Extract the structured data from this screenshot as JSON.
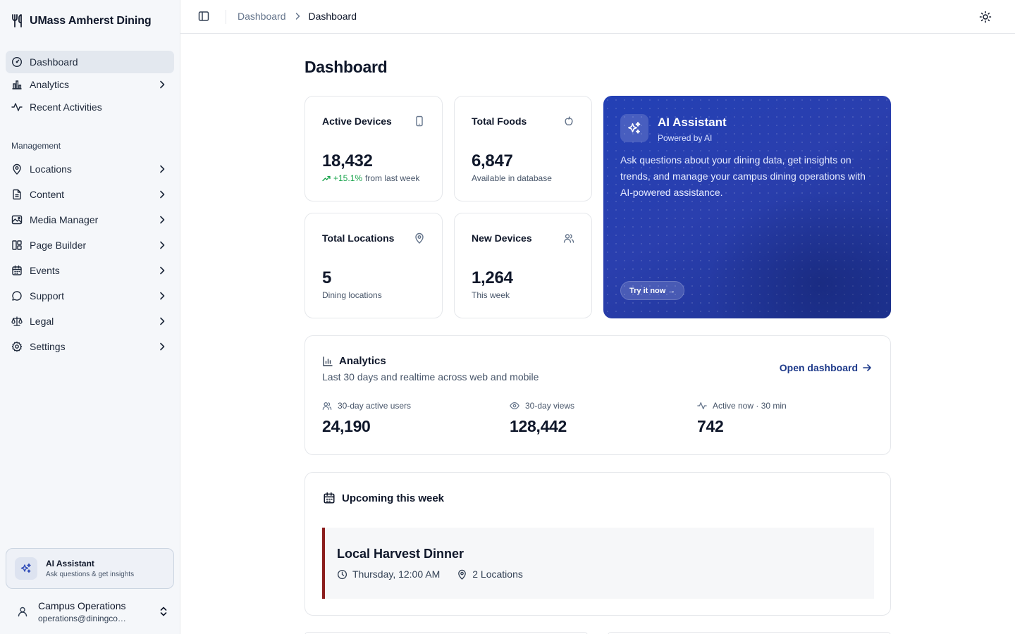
{
  "brand": {
    "name": "UMass Amherst Dining",
    "icon": "fork-knife-icon"
  },
  "sidebar": {
    "primary": [
      {
        "label": "Dashboard",
        "icon": "gauge-icon",
        "active": true
      },
      {
        "label": "Analytics",
        "icon": "bar-chart-icon",
        "has_submenu": true
      },
      {
        "label": "Recent Activities",
        "icon": "activity-icon"
      }
    ],
    "section_label": "Management",
    "management": [
      {
        "label": "Locations",
        "icon": "map-pin-icon"
      },
      {
        "label": "Content",
        "icon": "file-text-icon"
      },
      {
        "label": "Media Manager",
        "icon": "image-icon"
      },
      {
        "label": "Page Builder",
        "icon": "layout-icon"
      },
      {
        "label": "Events",
        "icon": "calendar-icon"
      },
      {
        "label": "Support",
        "icon": "message-circle-icon"
      },
      {
        "label": "Legal",
        "icon": "scale-icon"
      },
      {
        "label": "Settings",
        "icon": "gear-icon"
      }
    ],
    "ai_widget": {
      "title": "AI Assistant",
      "subtitle": "Ask questions & get insights",
      "icon": "sparkles-icon"
    },
    "user": {
      "name": "Campus Operations",
      "email": "operations@diningconnect.c...",
      "icon": "user-icon"
    }
  },
  "header": {
    "breadcrumb": [
      "Dashboard",
      "Dashboard"
    ]
  },
  "page": {
    "title": "Dashboard"
  },
  "stats": [
    {
      "title": "Active Devices",
      "value": "18,432",
      "trend": "+15.1%",
      "sub": "from last week",
      "icon": "smartphone-icon"
    },
    {
      "title": "Total Foods",
      "value": "6,847",
      "sub": "Available in database",
      "icon": "apple-icon"
    },
    {
      "title": "Total Locations",
      "value": "5",
      "sub": "Dining locations",
      "icon": "map-pin-icon"
    },
    {
      "title": "New Devices",
      "value": "1,264",
      "sub": "This week",
      "icon": "users-icon"
    }
  ],
  "ai_card": {
    "title": "AI Assistant",
    "subtitle": "Powered by AI",
    "description": "Ask questions about your dining data, get insights on trends, and manage your campus dining operations with AI-powered assistance.",
    "cta": "Try it now →",
    "colors": {
      "start": "#2340b5",
      "end": "#1d3291"
    }
  },
  "analytics": {
    "title": "Analytics",
    "description": "Last 30 days and realtime across web and mobile",
    "link": "Open dashboard",
    "metrics": [
      {
        "label": "30-day active users",
        "value": "24,190",
        "icon": "users-icon"
      },
      {
        "label": "30-day views",
        "value": "128,442",
        "icon": "eye-icon"
      },
      {
        "label": "Active now · 30 min",
        "value": "742",
        "icon": "activity-icon"
      }
    ]
  },
  "upcoming": {
    "title": "Upcoming this week",
    "events": [
      {
        "title": "Local Harvest Dinner",
        "time": "Thursday, 12:00 AM",
        "locations": "2 Locations",
        "accent": "#8b1d1d"
      }
    ]
  },
  "colors": {
    "trend_up": "#16a34a",
    "link": "#1e3a8a",
    "active_nav": "#e3e8ef"
  }
}
